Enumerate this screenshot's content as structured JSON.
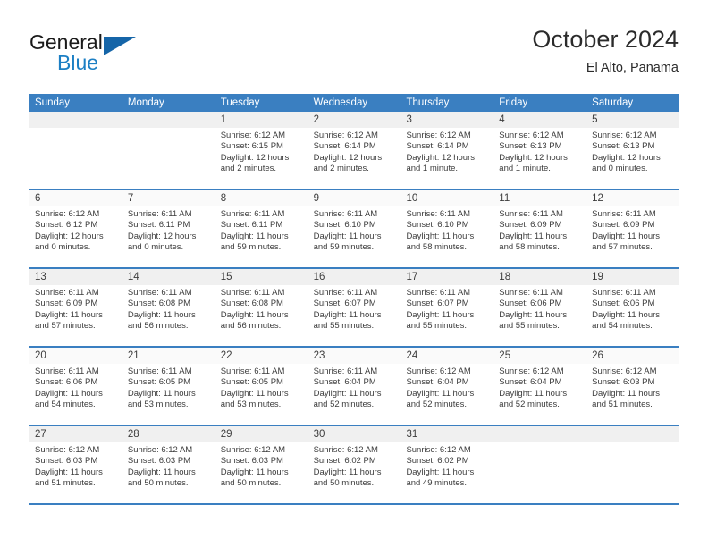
{
  "brand": {
    "line1": "General",
    "line2": "Blue",
    "triangle_icon": "triangle-icon",
    "color_dark": "#1a1a1a",
    "color_blue": "#1c7fc4",
    "color_triangle": "#1565a8"
  },
  "header": {
    "title": "October 2024",
    "subtitle": "El Alto, Panama"
  },
  "colors": {
    "header_band": "#3a7fc1",
    "row_separator": "#3a7fc1",
    "number_band": "#f0f0f0",
    "number_band_alt": "#fafafa",
    "cell_body": "#ffffff",
    "text": "#3c3c3c"
  },
  "weekdays": [
    "Sunday",
    "Monday",
    "Tuesday",
    "Wednesday",
    "Thursday",
    "Friday",
    "Saturday"
  ],
  "weeks": [
    {
      "days": [
        {
          "num": "",
          "sunrise": "",
          "sunset": "",
          "daylight_1": "",
          "daylight_2": ""
        },
        {
          "num": "",
          "sunrise": "",
          "sunset": "",
          "daylight_1": "",
          "daylight_2": ""
        },
        {
          "num": "1",
          "sunrise": "Sunrise: 6:12 AM",
          "sunset": "Sunset: 6:15 PM",
          "daylight_1": "Daylight: 12 hours",
          "daylight_2": "and 2 minutes."
        },
        {
          "num": "2",
          "sunrise": "Sunrise: 6:12 AM",
          "sunset": "Sunset: 6:14 PM",
          "daylight_1": "Daylight: 12 hours",
          "daylight_2": "and 2 minutes."
        },
        {
          "num": "3",
          "sunrise": "Sunrise: 6:12 AM",
          "sunset": "Sunset: 6:14 PM",
          "daylight_1": "Daylight: 12 hours",
          "daylight_2": "and 1 minute."
        },
        {
          "num": "4",
          "sunrise": "Sunrise: 6:12 AM",
          "sunset": "Sunset: 6:13 PM",
          "daylight_1": "Daylight: 12 hours",
          "daylight_2": "and 1 minute."
        },
        {
          "num": "5",
          "sunrise": "Sunrise: 6:12 AM",
          "sunset": "Sunset: 6:13 PM",
          "daylight_1": "Daylight: 12 hours",
          "daylight_2": "and 0 minutes."
        }
      ]
    },
    {
      "days": [
        {
          "num": "6",
          "sunrise": "Sunrise: 6:12 AM",
          "sunset": "Sunset: 6:12 PM",
          "daylight_1": "Daylight: 12 hours",
          "daylight_2": "and 0 minutes."
        },
        {
          "num": "7",
          "sunrise": "Sunrise: 6:11 AM",
          "sunset": "Sunset: 6:11 PM",
          "daylight_1": "Daylight: 12 hours",
          "daylight_2": "and 0 minutes."
        },
        {
          "num": "8",
          "sunrise": "Sunrise: 6:11 AM",
          "sunset": "Sunset: 6:11 PM",
          "daylight_1": "Daylight: 11 hours",
          "daylight_2": "and 59 minutes."
        },
        {
          "num": "9",
          "sunrise": "Sunrise: 6:11 AM",
          "sunset": "Sunset: 6:10 PM",
          "daylight_1": "Daylight: 11 hours",
          "daylight_2": "and 59 minutes."
        },
        {
          "num": "10",
          "sunrise": "Sunrise: 6:11 AM",
          "sunset": "Sunset: 6:10 PM",
          "daylight_1": "Daylight: 11 hours",
          "daylight_2": "and 58 minutes."
        },
        {
          "num": "11",
          "sunrise": "Sunrise: 6:11 AM",
          "sunset": "Sunset: 6:09 PM",
          "daylight_1": "Daylight: 11 hours",
          "daylight_2": "and 58 minutes."
        },
        {
          "num": "12",
          "sunrise": "Sunrise: 6:11 AM",
          "sunset": "Sunset: 6:09 PM",
          "daylight_1": "Daylight: 11 hours",
          "daylight_2": "and 57 minutes."
        }
      ]
    },
    {
      "days": [
        {
          "num": "13",
          "sunrise": "Sunrise: 6:11 AM",
          "sunset": "Sunset: 6:09 PM",
          "daylight_1": "Daylight: 11 hours",
          "daylight_2": "and 57 minutes."
        },
        {
          "num": "14",
          "sunrise": "Sunrise: 6:11 AM",
          "sunset": "Sunset: 6:08 PM",
          "daylight_1": "Daylight: 11 hours",
          "daylight_2": "and 56 minutes."
        },
        {
          "num": "15",
          "sunrise": "Sunrise: 6:11 AM",
          "sunset": "Sunset: 6:08 PM",
          "daylight_1": "Daylight: 11 hours",
          "daylight_2": "and 56 minutes."
        },
        {
          "num": "16",
          "sunrise": "Sunrise: 6:11 AM",
          "sunset": "Sunset: 6:07 PM",
          "daylight_1": "Daylight: 11 hours",
          "daylight_2": "and 55 minutes."
        },
        {
          "num": "17",
          "sunrise": "Sunrise: 6:11 AM",
          "sunset": "Sunset: 6:07 PM",
          "daylight_1": "Daylight: 11 hours",
          "daylight_2": "and 55 minutes."
        },
        {
          "num": "18",
          "sunrise": "Sunrise: 6:11 AM",
          "sunset": "Sunset: 6:06 PM",
          "daylight_1": "Daylight: 11 hours",
          "daylight_2": "and 55 minutes."
        },
        {
          "num": "19",
          "sunrise": "Sunrise: 6:11 AM",
          "sunset": "Sunset: 6:06 PM",
          "daylight_1": "Daylight: 11 hours",
          "daylight_2": "and 54 minutes."
        }
      ]
    },
    {
      "days": [
        {
          "num": "20",
          "sunrise": "Sunrise: 6:11 AM",
          "sunset": "Sunset: 6:06 PM",
          "daylight_1": "Daylight: 11 hours",
          "daylight_2": "and 54 minutes."
        },
        {
          "num": "21",
          "sunrise": "Sunrise: 6:11 AM",
          "sunset": "Sunset: 6:05 PM",
          "daylight_1": "Daylight: 11 hours",
          "daylight_2": "and 53 minutes."
        },
        {
          "num": "22",
          "sunrise": "Sunrise: 6:11 AM",
          "sunset": "Sunset: 6:05 PM",
          "daylight_1": "Daylight: 11 hours",
          "daylight_2": "and 53 minutes."
        },
        {
          "num": "23",
          "sunrise": "Sunrise: 6:11 AM",
          "sunset": "Sunset: 6:04 PM",
          "daylight_1": "Daylight: 11 hours",
          "daylight_2": "and 52 minutes."
        },
        {
          "num": "24",
          "sunrise": "Sunrise: 6:12 AM",
          "sunset": "Sunset: 6:04 PM",
          "daylight_1": "Daylight: 11 hours",
          "daylight_2": "and 52 minutes."
        },
        {
          "num": "25",
          "sunrise": "Sunrise: 6:12 AM",
          "sunset": "Sunset: 6:04 PM",
          "daylight_1": "Daylight: 11 hours",
          "daylight_2": "and 52 minutes."
        },
        {
          "num": "26",
          "sunrise": "Sunrise: 6:12 AM",
          "sunset": "Sunset: 6:03 PM",
          "daylight_1": "Daylight: 11 hours",
          "daylight_2": "and 51 minutes."
        }
      ]
    },
    {
      "days": [
        {
          "num": "27",
          "sunrise": "Sunrise: 6:12 AM",
          "sunset": "Sunset: 6:03 PM",
          "daylight_1": "Daylight: 11 hours",
          "daylight_2": "and 51 minutes."
        },
        {
          "num": "28",
          "sunrise": "Sunrise: 6:12 AM",
          "sunset": "Sunset: 6:03 PM",
          "daylight_1": "Daylight: 11 hours",
          "daylight_2": "and 50 minutes."
        },
        {
          "num": "29",
          "sunrise": "Sunrise: 6:12 AM",
          "sunset": "Sunset: 6:03 PM",
          "daylight_1": "Daylight: 11 hours",
          "daylight_2": "and 50 minutes."
        },
        {
          "num": "30",
          "sunrise": "Sunrise: 6:12 AM",
          "sunset": "Sunset: 6:02 PM",
          "daylight_1": "Daylight: 11 hours",
          "daylight_2": "and 50 minutes."
        },
        {
          "num": "31",
          "sunrise": "Sunrise: 6:12 AM",
          "sunset": "Sunset: 6:02 PM",
          "daylight_1": "Daylight: 11 hours",
          "daylight_2": "and 49 minutes."
        },
        {
          "num": "",
          "sunrise": "",
          "sunset": "",
          "daylight_1": "",
          "daylight_2": ""
        },
        {
          "num": "",
          "sunrise": "",
          "sunset": "",
          "daylight_1": "",
          "daylight_2": ""
        }
      ]
    }
  ]
}
